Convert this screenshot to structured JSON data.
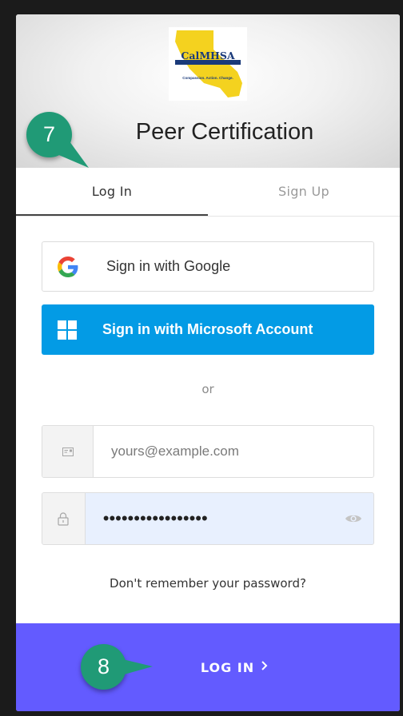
{
  "header": {
    "logo": {
      "name": "CalMHSA",
      "tagline": "Compassion. Action. Change."
    },
    "title": "Peer Certification"
  },
  "tabs": [
    {
      "label": "Log In",
      "active": true
    },
    {
      "label": "Sign Up",
      "active": false
    }
  ],
  "social": {
    "google_label": "Sign in with Google",
    "microsoft_label": "Sign in with Microsoft Account"
  },
  "divider": "or",
  "form": {
    "email_placeholder": "yours@example.com",
    "email_value": "",
    "password_value": "•••••••••••••••••"
  },
  "forgot_password": "Don't remember your password?",
  "submit": {
    "label": "LOG IN"
  },
  "callouts": {
    "step_a": "7",
    "step_b": "8"
  },
  "colors": {
    "microsoft_blue": "#039be5",
    "submit_purple": "#635bff",
    "callout_green": "#209a76",
    "autofill_blue": "#e8f0fe"
  },
  "icons": {
    "google": "google-g-icon",
    "microsoft": "microsoft-windows-icon",
    "email": "envelope-icon",
    "password": "lock-icon",
    "toggle": "eye-icon",
    "submit": "chevron-right-icon"
  }
}
